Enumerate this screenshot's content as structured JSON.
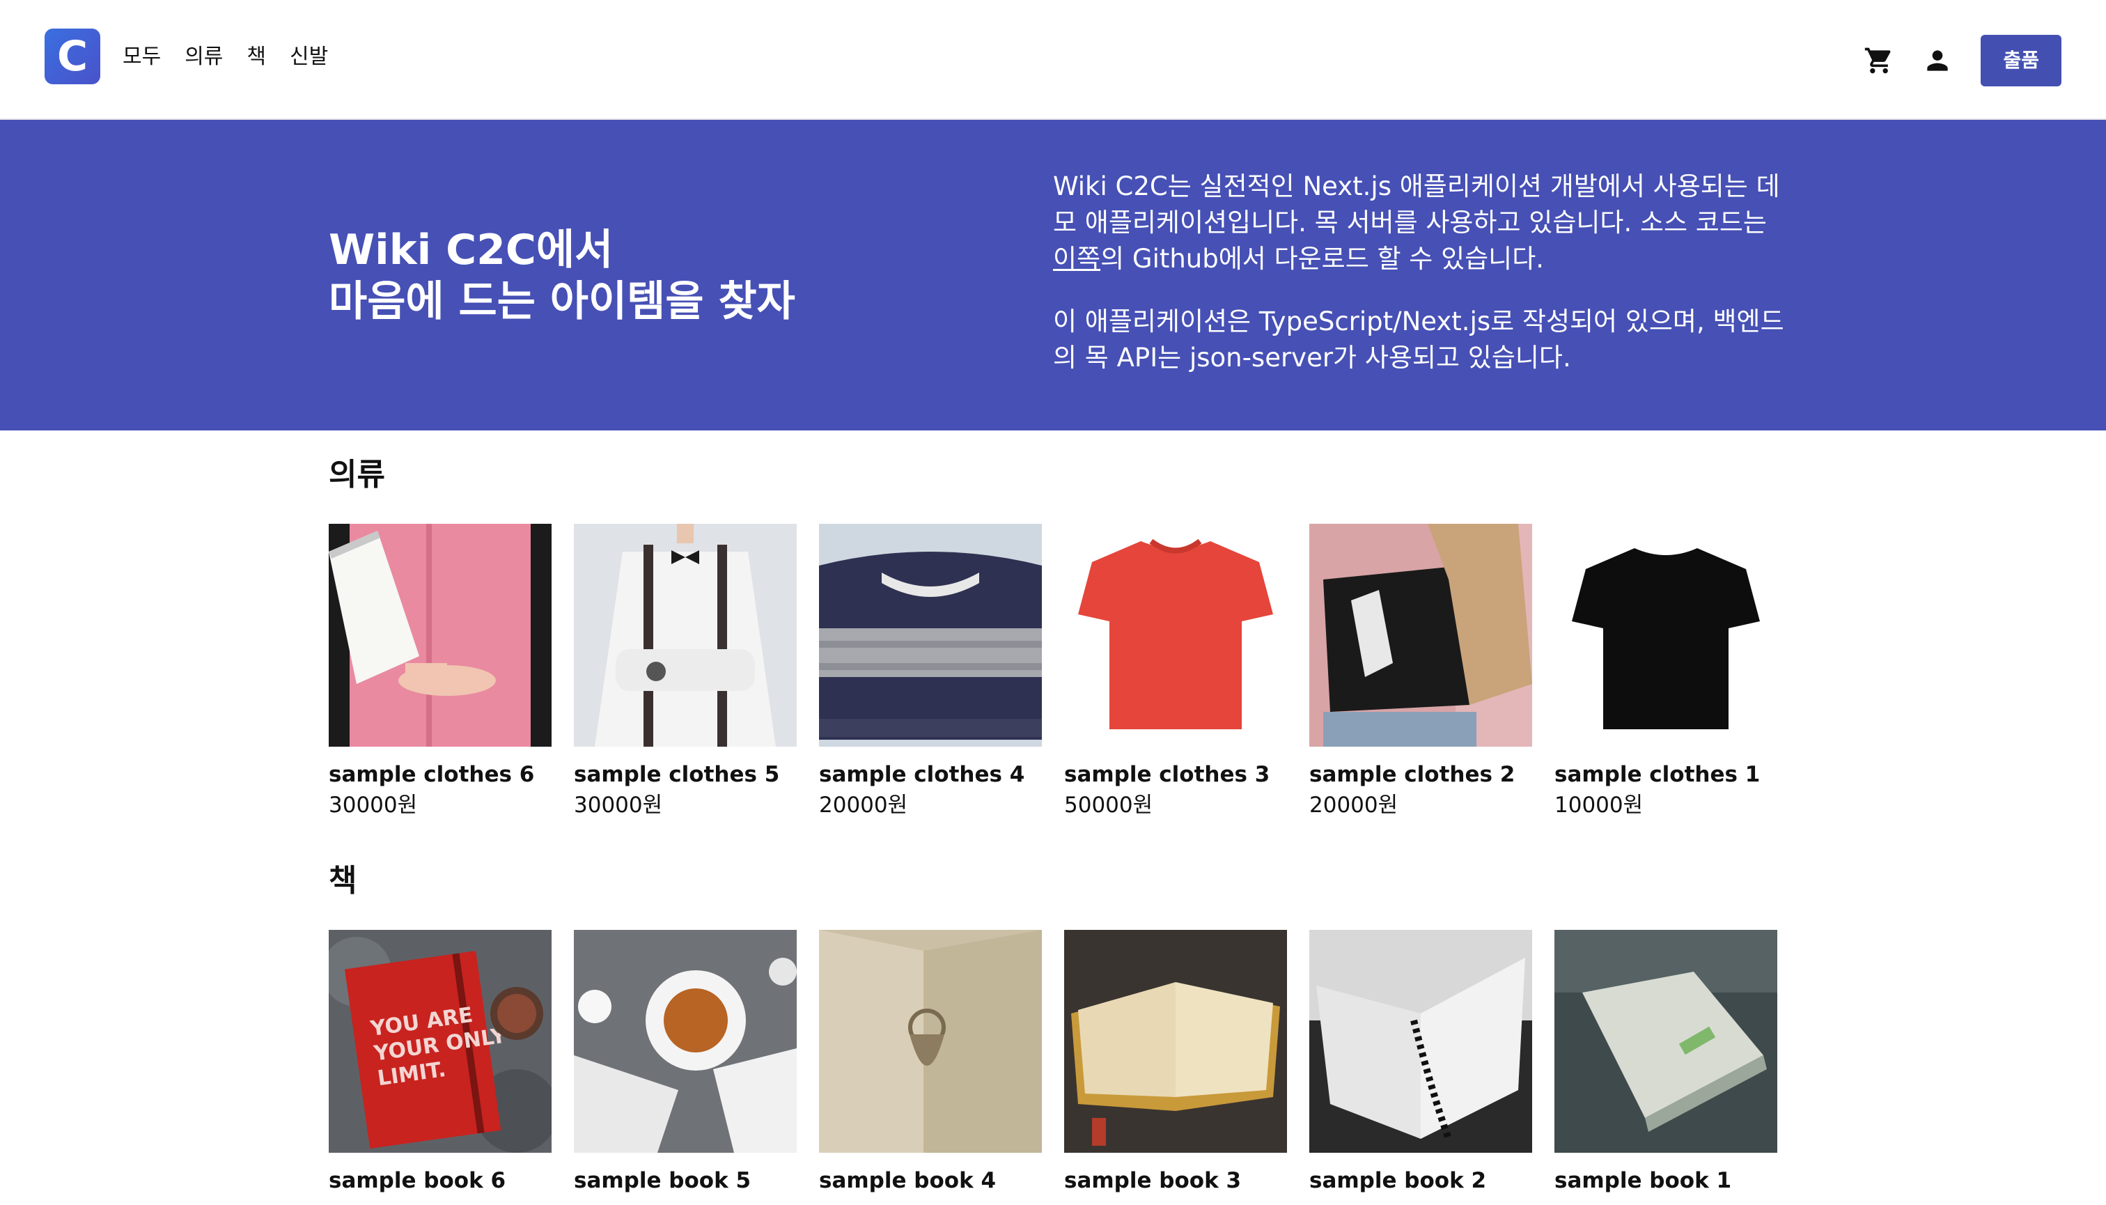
{
  "header": {
    "logo_letter": "C",
    "nav": [
      "모두",
      "의류",
      "책",
      "신발"
    ],
    "icons": [
      "shopping-cart-icon",
      "person-icon"
    ],
    "submit_label": "출품"
  },
  "hero": {
    "title_line1": "Wiki C2C에서",
    "title_line2": "마음에 드는 아이템을 찾자",
    "desc1_part1": "Wiki C2C는 실전적인 Next.js 애플리케이션 개발에서 사용되는 데모 애플리케이션입니다. 목 서버를 사용하고 있습니다. 소스 코드는 ",
    "desc1_link": "이쪽",
    "desc1_part2": "의 Github에서 다운로드 할 수 있습니다.",
    "desc2": "이 애플리케이션은 TypeScript/Next.js로 작성되어 있으며, 백엔드의 목 API는 json-server가 사용되고 있습니다."
  },
  "sections": [
    {
      "title": "의류",
      "items": [
        {
          "name": "sample clothes 6",
          "price": "30000원"
        },
        {
          "name": "sample clothes 5",
          "price": "30000원"
        },
        {
          "name": "sample clothes 4",
          "price": "20000원"
        },
        {
          "name": "sample clothes 3",
          "price": "50000원"
        },
        {
          "name": "sample clothes 2",
          "price": "20000원"
        },
        {
          "name": "sample clothes 1",
          "price": "10000원"
        }
      ]
    },
    {
      "title": "책",
      "items": [
        {
          "name": "sample book 6",
          "price": ""
        },
        {
          "name": "sample book 5",
          "price": ""
        },
        {
          "name": "sample book 4",
          "price": ""
        },
        {
          "name": "sample book 3",
          "price": ""
        },
        {
          "name": "sample book 2",
          "price": ""
        },
        {
          "name": "sample book 1",
          "price": ""
        }
      ]
    }
  ],
  "book6_cover_text": [
    "YOU ARE",
    "YOUR ONLY",
    "LIMIT."
  ],
  "colors": {
    "accent": "#4350b1",
    "hero_bg": "#4650b5",
    "logo_start": "#3a6fe0",
    "logo_end": "#4a52c9"
  }
}
